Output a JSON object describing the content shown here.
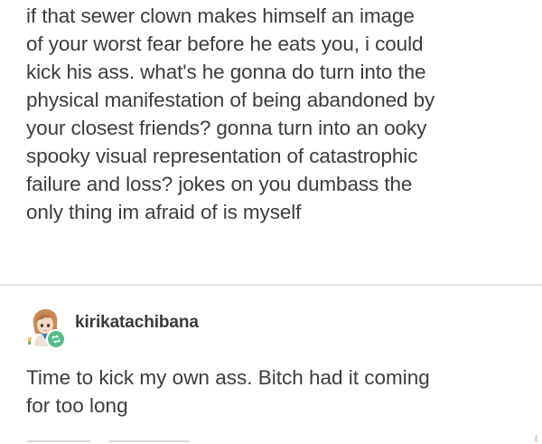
{
  "original_post": {
    "text": "if that sewer clown makes himself an image\nof your worst fear before he eats you, i could\nkick his ass. what's he gonna do turn into the\nphysical manifestation of being abandoned by\nyour closest friends? gonna turn into an ooky\nspooky visual representation of catastrophic\nfailure and loss? jokes on you dumbass the\nonly thing im afraid of is myself"
  },
  "reblog": {
    "username": "kirikatachibana",
    "avatar_icon": "anime-avatar-icon",
    "badge_icon": "reblog-icon",
    "badge_color": "#56bc8a",
    "text": "Time to kick my own ass. Bitch had it coming\nfor too long"
  }
}
